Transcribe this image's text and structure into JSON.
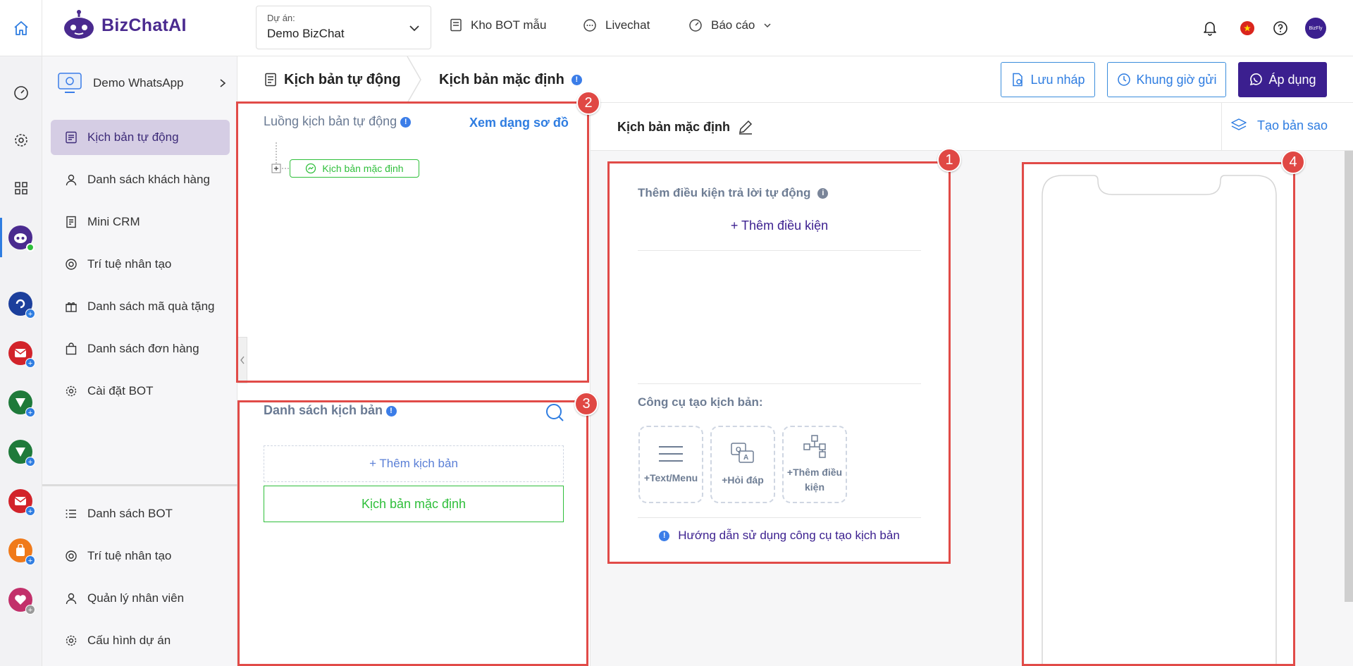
{
  "header": {
    "brand": "BizChatAI",
    "project_label": "Dự án:",
    "project_value": "Demo BizChat",
    "nav": [
      {
        "label": "Kho BOT mẫu"
      },
      {
        "label": "Livechat"
      },
      {
        "label": "Báo cáo"
      }
    ],
    "avatar_text": "BizFly"
  },
  "sidebar": {
    "channel": "Demo WhatsApp",
    "items": [
      {
        "label": "Kịch bản tự động"
      },
      {
        "label": "Danh sách khách hàng"
      },
      {
        "label": "Mini CRM"
      },
      {
        "label": "Trí tuệ nhân tạo"
      },
      {
        "label": "Danh sách mã quà tặng"
      },
      {
        "label": "Danh sách đơn hàng"
      },
      {
        "label": "Cài đặt BOT"
      }
    ],
    "bottom_items": [
      {
        "label": "Danh sách BOT"
      },
      {
        "label": "Trí tuệ nhân tạo"
      },
      {
        "label": "Quản lý nhân viên"
      },
      {
        "label": "Cấu hình dự án"
      }
    ]
  },
  "tabs": {
    "tab1": "Kịch bản tự động",
    "tab2": "Kịch bản mặc định"
  },
  "actions": {
    "draft": "Lưu nháp",
    "schedule": "Khung giờ gửi",
    "apply": "Áp dụng",
    "duplicate": "Tạo bản sao"
  },
  "flow_panel": {
    "title": "Luồng kịch bản tự động",
    "diagram_link": "Xem dạng sơ đồ",
    "node": "Kịch bản mặc định"
  },
  "script_list": {
    "title": "Danh sách kịch bản",
    "add": "+ Thêm kịch bản",
    "items": [
      "Kịch bản mặc định"
    ]
  },
  "editor": {
    "title": "Kịch bản mặc định",
    "condition_title": "Thêm điều kiện trả lời tự động",
    "add_condition": "+ Thêm điều kiện",
    "tools_title": "Công cụ tạo kịch bản:",
    "tools": [
      {
        "label": "+Text/Menu",
        "icon": "menu-lines-icon"
      },
      {
        "label": "+Hỏi đáp",
        "icon": "qa-icon"
      },
      {
        "label": "+Thêm điều kiện",
        "icon": "flow-branch-icon"
      }
    ],
    "guide": "Hướng dẫn sử dụng công cụ tạo kịch bản"
  },
  "annotations": [
    "1",
    "2",
    "3",
    "4"
  ],
  "colors": {
    "brand": "#4a2a8f",
    "accent_blue": "#2f7de1",
    "apply_bg": "#3b1f8f",
    "success_green": "#2fbf3b",
    "annotation_red": "#e14b48"
  }
}
